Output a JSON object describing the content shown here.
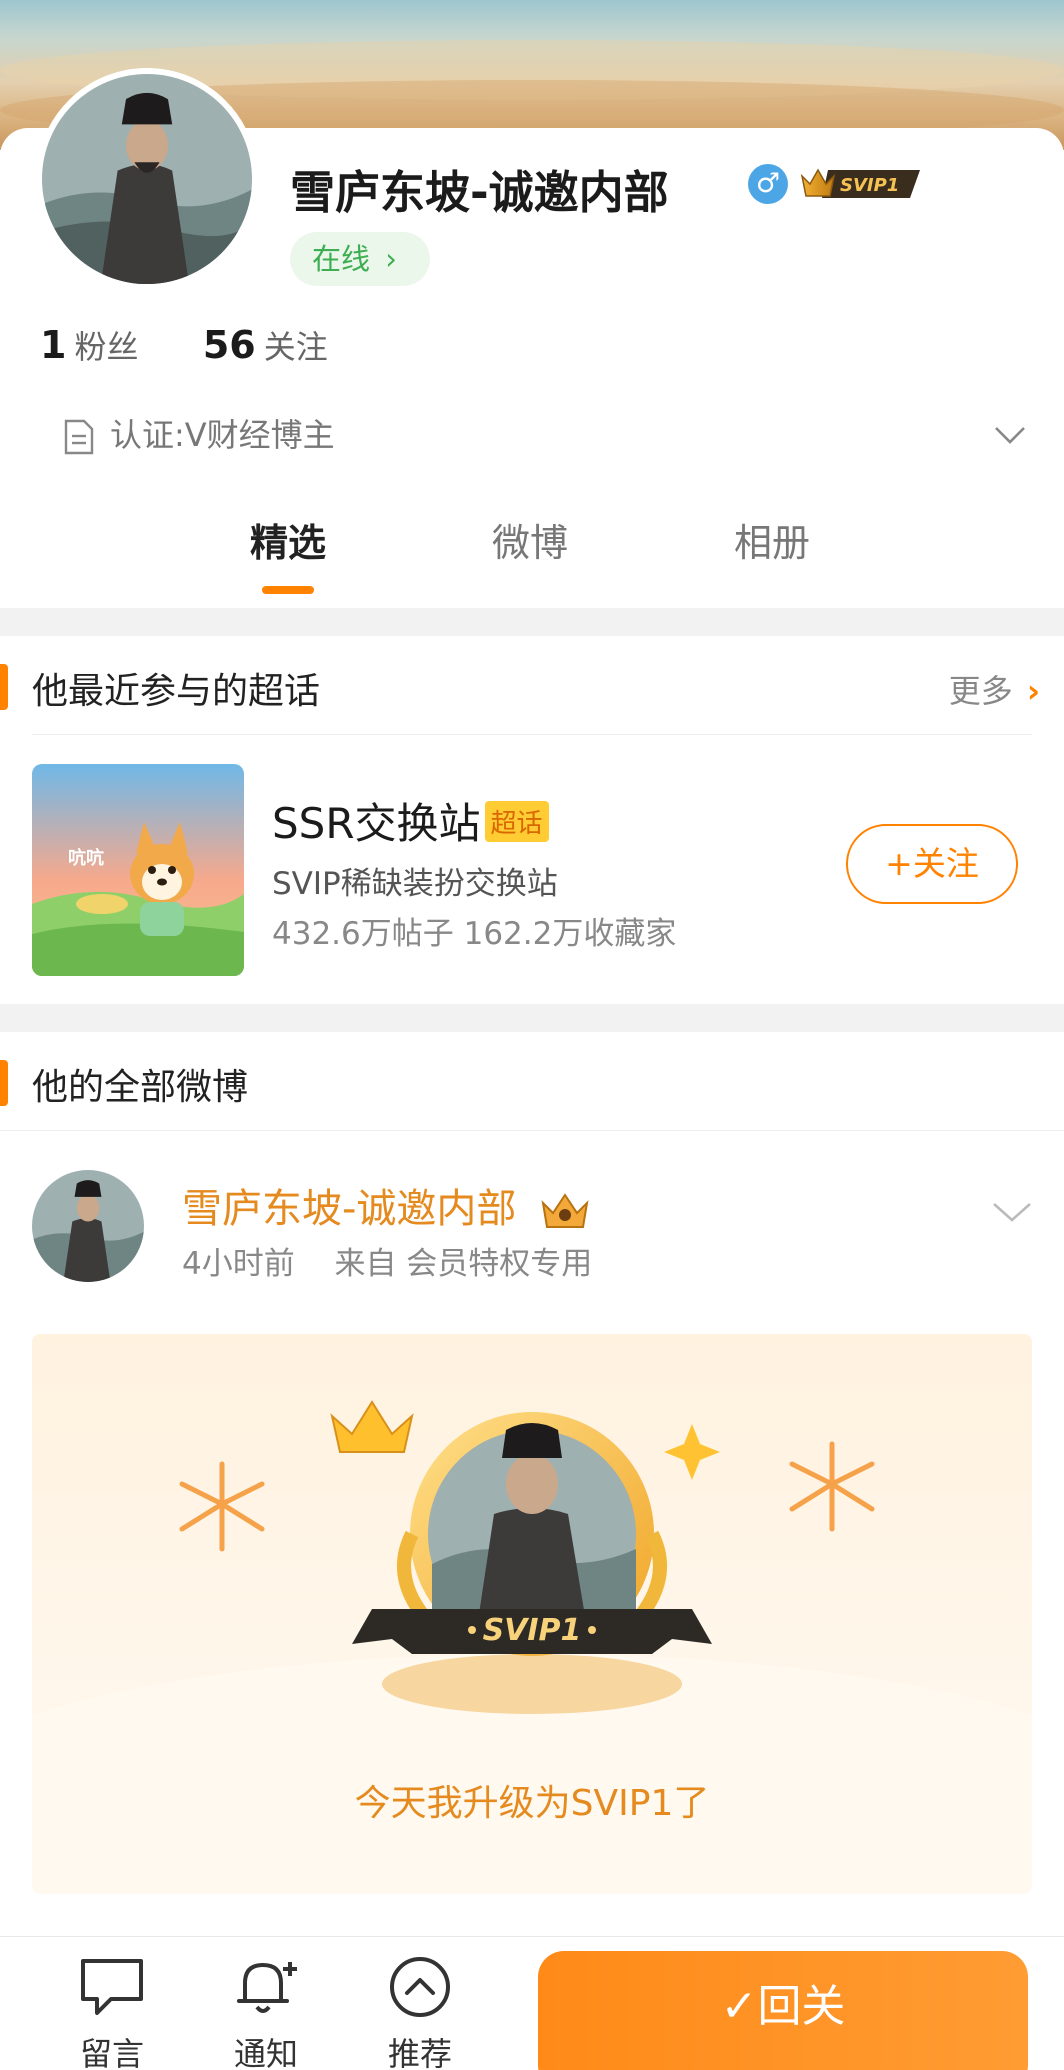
{
  "profile": {
    "name": "雪庐东坡-诚邀内部",
    "gender_symbol": "♂",
    "svip_badge": "SVIP1",
    "online_label": "在线",
    "stats": [
      {
        "value": "1",
        "label": "粉丝"
      },
      {
        "value": "56",
        "label": "关注"
      }
    ],
    "verification": "认证:V财经博主"
  },
  "tabs": [
    {
      "label": "精选",
      "active": true
    },
    {
      "label": "微博",
      "active": false
    },
    {
      "label": "相册",
      "active": false
    }
  ],
  "topics_section": {
    "title": "他最近参与的超话",
    "more_label": "更多",
    "topic": {
      "name": "SSR交换站",
      "tag": "超话",
      "description": "SVIP稀缺装扮交换站",
      "stats": "432.6万帖子 162.2万收藏家",
      "follow_label": "+关注"
    }
  },
  "posts_section": {
    "title": "他的全部微博",
    "post": {
      "author": "雪庐东坡-诚邀内部",
      "time": "4小时前",
      "source": "来自 会员特权专用",
      "card_badge": "SVIP1",
      "card_text": "今天我升级为SVIP1了"
    }
  },
  "bottom_bar": {
    "items": [
      {
        "label": "留言",
        "icon": "chat-icon"
      },
      {
        "label": "通知",
        "icon": "bell-plus-icon"
      },
      {
        "label": "推荐",
        "icon": "chevron-up-circle-icon"
      }
    ],
    "return_label": "回关"
  },
  "colors": {
    "accent": "#ff8200",
    "online_green": "#3fae52",
    "vip_orange": "#e58a1f"
  }
}
